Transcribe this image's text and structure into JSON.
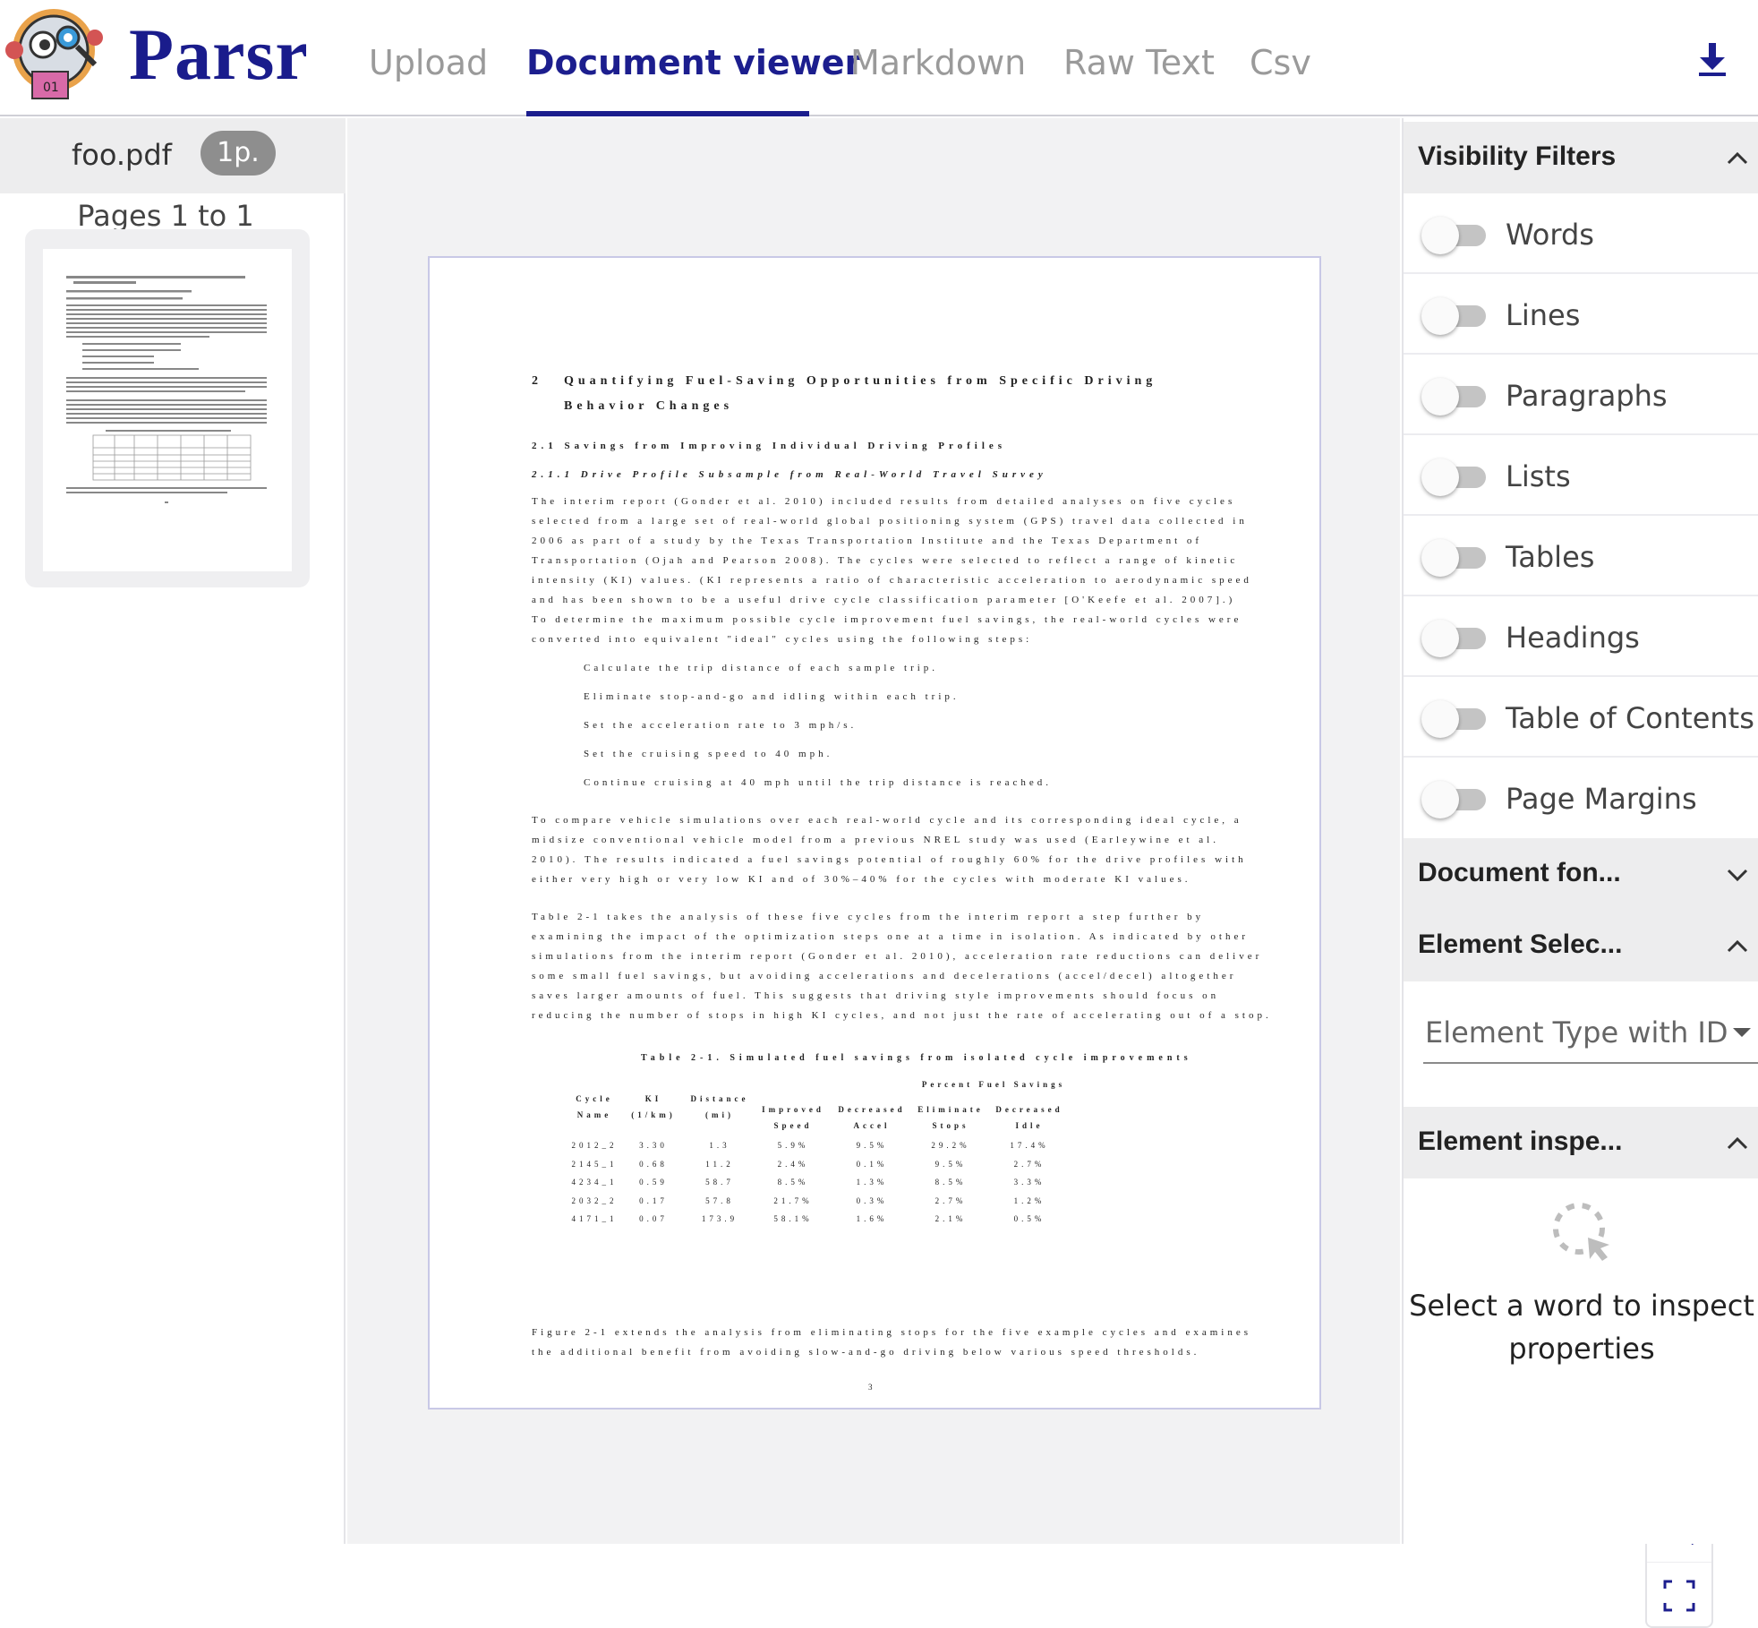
{
  "app": {
    "name": "Parsr"
  },
  "tabs": [
    {
      "label": "Upload",
      "active": false
    },
    {
      "label": "Document viewer",
      "active": true
    },
    {
      "label": "Markdown",
      "active": false
    },
    {
      "label": "Raw Text",
      "active": false
    },
    {
      "label": "Csv",
      "active": false
    }
  ],
  "file": {
    "name": "foo.pdf",
    "pages_badge": "1p.",
    "pages_range": "Pages 1 to 1"
  },
  "document": {
    "heading_num": "2",
    "heading": "Quantifying Fuel-Saving Opportunities from Specific Driving",
    "heading_cont": "Behavior Changes",
    "sec_2_1": "2.1    Savings from Improving Individual Driving Profiles",
    "sec_2_1_1": "2.1.1    Drive Profile Subsample from Real-World Travel Survey",
    "para1": [
      "The interim report (Gonder et al. 2010) included results from detailed analyses on five cycles",
      "selected from a large set of real-world global positioning system (GPS) travel data collected in",
      "2006 as part of a study by the Texas Transportation Institute and the Texas Department of",
      "Transportation (Ojah and Pearson 2008). The cycles were selected to reflect a range of kinetic",
      "intensity (KI) values. (KI represents a ratio of characteristic acceleration to aerodynamic speed",
      "and has been shown to be a useful drive cycle classification parameter [O'Keefe et al. 2007].)",
      "To determine the maximum possible cycle improvement fuel savings, the real-world cycles were",
      "converted into equivalent \"ideal\" cycles using the following steps:"
    ],
    "steps": [
      "Calculate the trip distance of each sample trip.",
      "Eliminate stop-and-go and idling within each trip.",
      "Set the acceleration rate to 3 mph/s.",
      "Set the cruising speed to 40 mph.",
      "Continue cruising at 40 mph until the trip distance is reached."
    ],
    "para2": [
      "To compare vehicle simulations over each real-world cycle and its corresponding ideal cycle, a",
      "midsize conventional vehicle model from a previous NREL study was used (Earleywine et al.",
      "2010). The results indicated a fuel savings potential of roughly 60% for the drive profiles with",
      "either very high or very low KI and of 30%–40% for the cycles with moderate KI values."
    ],
    "para3": [
      "Table 2-1 takes the analysis of these five cycles from the interim report a step further by",
      "examining the impact of the optimization steps one at a time in isolation. As indicated by other",
      "simulations from the interim report (Gonder et al. 2010), acceleration rate reductions can deliver",
      "some small fuel savings, but avoiding accelerations and decelerations (accel/decel) altogether",
      "saves larger amounts of fuel. This suggests that driving style improvements should focus on",
      "reducing the number of stops in high KI cycles, and not just the rate of accelerating out of a stop."
    ],
    "table_caption": "Table 2-1. Simulated fuel savings from isolated cycle improvements",
    "table": {
      "group_header": "Percent Fuel Savings",
      "headers": [
        "Cycle Name",
        "KI (1/km)",
        "Distance (mi)",
        "Improved Speed",
        "Decreased Accel",
        "Eliminate Stops",
        "Decreased Idle"
      ],
      "rows": [
        [
          "2012_2",
          "3.30",
          "1.3",
          "5.9%",
          "9.5%",
          "29.2%",
          "17.4%"
        ],
        [
          "2145_1",
          "0.68",
          "11.2",
          "2.4%",
          "0.1%",
          "9.5%",
          "2.7%"
        ],
        [
          "4234_1",
          "0.59",
          "58.7",
          "8.5%",
          "1.3%",
          "8.5%",
          "3.3%"
        ],
        [
          "2032_2",
          "0.17",
          "57.8",
          "21.7%",
          "0.3%",
          "2.7%",
          "1.2%"
        ],
        [
          "4171_1",
          "0.07",
          "173.9",
          "58.1%",
          "1.6%",
          "2.1%",
          "0.5%"
        ]
      ]
    },
    "para4": [
      "Figure 2-1 extends the analysis from eliminating stops for the five example cycles and examines",
      "the additional benefit from avoiding slow-and-go driving below various speed thresholds."
    ],
    "page_number": "3"
  },
  "right_panel": {
    "visibility_title": "Visibility Filters",
    "filters": [
      {
        "label": "Words",
        "on": false
      },
      {
        "label": "Lines",
        "on": false
      },
      {
        "label": "Paragraphs",
        "on": false
      },
      {
        "label": "Lists",
        "on": false
      },
      {
        "label": "Tables",
        "on": false
      },
      {
        "label": "Headings",
        "on": false
      },
      {
        "label": "Table of Contents",
        "on": false
      },
      {
        "label": "Page Margins",
        "on": false
      }
    ],
    "document_fonts_title": "Document fon...",
    "element_selection_title": "Element Selec...",
    "element_select_value": "Element Type with ID",
    "element_inspector_title": "Element inspe...",
    "inspect_message": "Select a word to inspect properties"
  },
  "icons": {
    "download": "download-icon",
    "zoom_in": "zoom-in-icon",
    "zoom_out": "zoom-out-icon",
    "fullscreen": "fullscreen-icon",
    "inspect": "inspect-cursor-icon",
    "chevron_up": "chevron-up-icon",
    "chevron_down": "chevron-down-icon"
  },
  "colors": {
    "brand": "#1a1c8c",
    "active_tab": "#1c1e8e",
    "inactive_tab": "#9a9a9a",
    "panel_header": "#ededee",
    "viewer_bg": "#f2f2f3"
  }
}
